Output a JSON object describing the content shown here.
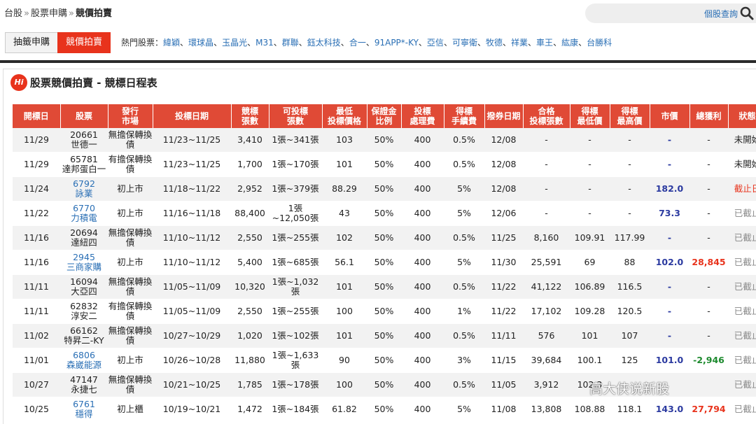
{
  "breadcrumb": {
    "items": [
      "台股",
      "股票申購",
      "競價拍賣"
    ],
    "sep": "»"
  },
  "search": {
    "label": "個股查詢",
    "icon": "search-icon"
  },
  "tabs": [
    "抽籤申購",
    "競價拍賣"
  ],
  "hot": {
    "label": "熱門股票：",
    "stocks": [
      "緯穎",
      "環球晶",
      "玉晶光",
      "M31",
      "群聯",
      "鈺太科技",
      "合一",
      "91APP*-KY",
      "亞信",
      "可寧衛",
      "牧德",
      "祥業",
      "車王",
      "紘康",
      "台勝科"
    ]
  },
  "panel": {
    "badge": "Hi",
    "title": "股票競價拍賣 - 競標日程表"
  },
  "columns": [
    [
      "開標日"
    ],
    [
      "股票"
    ],
    [
      "發行",
      "市場"
    ],
    [
      "投標日期"
    ],
    [
      "競標",
      "張數"
    ],
    [
      "可投標",
      "張數"
    ],
    [
      "最低",
      "投標價格"
    ],
    [
      "保證金",
      "比例"
    ],
    [
      "投標",
      "處理費"
    ],
    [
      "得標",
      "手續費"
    ],
    [
      "撥券日期"
    ],
    [
      "合格",
      "投標張數"
    ],
    [
      "得標",
      "最低價"
    ],
    [
      "得標",
      "最高價"
    ],
    [
      "市價"
    ],
    [
      "總獲利"
    ],
    [
      "狀態"
    ]
  ],
  "rows": [
    {
      "open": "11/29",
      "code": "20661",
      "name": "世德一",
      "link": false,
      "market": [
        "無擔保轉換",
        "債"
      ],
      "bid_dates": "11/23~11/25",
      "lots": "3,410",
      "bid_lots": [
        "1張~341張"
      ],
      "min_price": "103",
      "margin": "50%",
      "fee": "400",
      "win_fee": "0.5%",
      "issue": "12/08",
      "qualified": "-",
      "win_min": "-",
      "win_max": "-",
      "market_price": "-",
      "profit": "-",
      "profit_kind": "",
      "status": "未開始",
      "status_kind": "normal"
    },
    {
      "open": "11/29",
      "code": "65781",
      "name": "達邦蛋白一",
      "link": false,
      "market": [
        "有擔保轉換",
        "債"
      ],
      "bid_dates": "11/23~11/25",
      "lots": "1,700",
      "bid_lots": [
        "1張~170張"
      ],
      "min_price": "101",
      "margin": "50%",
      "fee": "400",
      "win_fee": "0.5%",
      "issue": "12/08",
      "qualified": "-",
      "win_min": "-",
      "win_max": "-",
      "market_price": "-",
      "profit": "-",
      "profit_kind": "",
      "status": "未開始",
      "status_kind": "normal"
    },
    {
      "open": "11/24",
      "code": "6792",
      "name": "詠業",
      "link": true,
      "market": [
        "初上市"
      ],
      "bid_dates": "11/18~11/22",
      "lots": "2,952",
      "bid_lots": [
        "1張~379張"
      ],
      "min_price": "88.29",
      "margin": "50%",
      "fee": "400",
      "win_fee": "5%",
      "issue": "12/08",
      "qualified": "-",
      "win_min": "-",
      "win_max": "-",
      "market_price": "182.0",
      "profit": "-",
      "profit_kind": "",
      "status": "截止日",
      "status_kind": "red"
    },
    {
      "open": "11/22",
      "code": "6770",
      "name": "力積電",
      "link": true,
      "market": [
        "初上市"
      ],
      "bid_dates": "11/16~11/18",
      "lots": "88,400",
      "bid_lots": [
        "1張",
        "~12,050張"
      ],
      "min_price": "43",
      "margin": "50%",
      "fee": "400",
      "win_fee": "5%",
      "issue": "12/06",
      "qualified": "-",
      "win_min": "-",
      "win_max": "-",
      "market_price": "73.3",
      "profit": "-",
      "profit_kind": "",
      "status": "已截止",
      "status_kind": "gray"
    },
    {
      "open": "11/16",
      "code": "20694",
      "name": "達紐四",
      "link": false,
      "market": [
        "無擔保轉換",
        "債"
      ],
      "bid_dates": "11/10~11/12",
      "lots": "2,550",
      "bid_lots": [
        "1張~255張"
      ],
      "min_price": "102",
      "margin": "50%",
      "fee": "400",
      "win_fee": "0.5%",
      "issue": "11/25",
      "qualified": "8,160",
      "win_min": "109.91",
      "win_max": "117.99",
      "market_price": "-",
      "profit": "-",
      "profit_kind": "",
      "status": "已截止",
      "status_kind": "gray"
    },
    {
      "open": "11/16",
      "code": "2945",
      "name": "三商家購",
      "link": true,
      "market": [
        "初上市"
      ],
      "bid_dates": "11/10~11/12",
      "lots": "5,400",
      "bid_lots": [
        "1張~685張"
      ],
      "min_price": "56.1",
      "margin": "50%",
      "fee": "400",
      "win_fee": "5%",
      "issue": "11/30",
      "qualified": "25,591",
      "win_min": "69",
      "win_max": "88",
      "market_price": "102.0",
      "profit": "28,845",
      "profit_kind": "pos",
      "status": "已截止",
      "status_kind": "gray"
    },
    {
      "open": "11/11",
      "code": "16094",
      "name": "大亞四",
      "link": false,
      "market": [
        "無擔保轉換",
        "債"
      ],
      "bid_dates": "11/05~11/09",
      "lots": "10,320",
      "bid_lots": [
        "1張~1,032",
        "張"
      ],
      "min_price": "101",
      "margin": "50%",
      "fee": "400",
      "win_fee": "0.5%",
      "issue": "11/22",
      "qualified": "41,122",
      "win_min": "106.89",
      "win_max": "116.5",
      "market_price": "-",
      "profit": "-",
      "profit_kind": "",
      "status": "已截止",
      "status_kind": "gray"
    },
    {
      "open": "11/11",
      "code": "62832",
      "name": "淳安二",
      "link": false,
      "market": [
        "有擔保轉換",
        "債"
      ],
      "bid_dates": "11/05~11/09",
      "lots": "2,550",
      "bid_lots": [
        "1張~255張"
      ],
      "min_price": "100",
      "margin": "50%",
      "fee": "400",
      "win_fee": "1%",
      "issue": "11/22",
      "qualified": "17,102",
      "win_min": "109.28",
      "win_max": "120.5",
      "market_price": "-",
      "profit": "-",
      "profit_kind": "",
      "status": "已截止",
      "status_kind": "gray"
    },
    {
      "open": "11/02",
      "code": "66162",
      "name": "特昇二-KY",
      "link": false,
      "market": [
        "無擔保轉換",
        "債"
      ],
      "bid_dates": "10/27~10/29",
      "lots": "1,020",
      "bid_lots": [
        "1張~102張"
      ],
      "min_price": "101",
      "margin": "50%",
      "fee": "400",
      "win_fee": "0.5%",
      "issue": "11/11",
      "qualified": "576",
      "win_min": "101",
      "win_max": "107",
      "market_price": "-",
      "profit": "-",
      "profit_kind": "",
      "status": "已截止",
      "status_kind": "gray"
    },
    {
      "open": "11/01",
      "code": "6806",
      "name": "森崴能源",
      "link": true,
      "market": [
        "初上市"
      ],
      "bid_dates": "10/26~10/28",
      "lots": "11,880",
      "bid_lots": [
        "1張~1,633",
        "張"
      ],
      "min_price": "90",
      "margin": "50%",
      "fee": "400",
      "win_fee": "3%",
      "issue": "11/15",
      "qualified": "39,684",
      "win_min": "100.1",
      "win_max": "125",
      "market_price": "101.0",
      "profit": "-2,946",
      "profit_kind": "neg",
      "status": "已截止",
      "status_kind": "gray"
    },
    {
      "open": "10/27",
      "code": "47147",
      "name": "永捷七",
      "link": false,
      "market": [
        "無擔保轉換",
        "債"
      ],
      "bid_dates": "10/21~10/25",
      "lots": "1,785",
      "bid_lots": [
        "1張~178張"
      ],
      "min_price": "100",
      "margin": "50%",
      "fee": "400",
      "win_fee": "0.5%",
      "issue": "11/05",
      "qualified": "3,912",
      "win_min": "102.3",
      "win_max": "",
      "market_price": "",
      "profit": "",
      "profit_kind": "",
      "status": "已截止",
      "status_kind": "gray"
    },
    {
      "open": "10/25",
      "code": "6761",
      "name": "穩得",
      "link": true,
      "market": [
        "初上櫃"
      ],
      "bid_dates": "10/19~10/21",
      "lots": "1,472",
      "bid_lots": [
        "1張~184張"
      ],
      "min_price": "61.82",
      "margin": "50%",
      "fee": "400",
      "win_fee": "5%",
      "issue": "11/08",
      "qualified": "13,808",
      "win_min": "108.88",
      "win_max": "118.1",
      "market_price": "143.0",
      "profit": "27,794",
      "profit_kind": "pos",
      "status": "已截止",
      "status_kind": "gray"
    }
  ],
  "watermark": "高大侠说新股"
}
